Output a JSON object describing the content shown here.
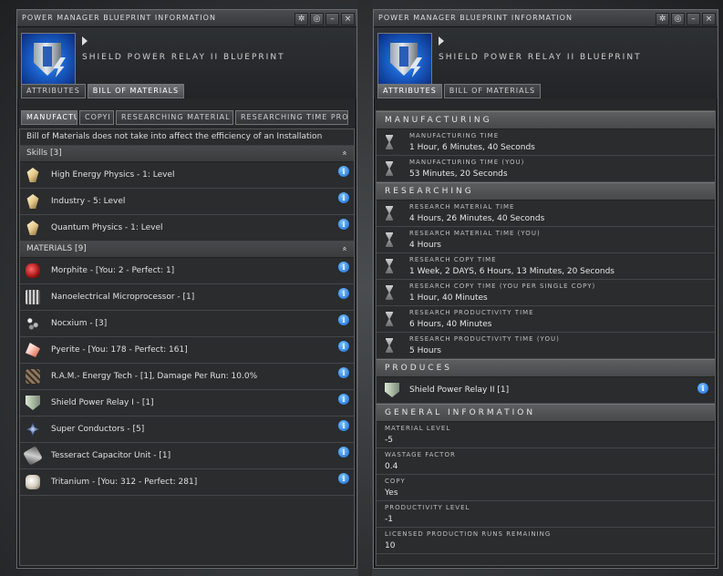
{
  "left_window": {
    "title": "Power Manager Blueprint Information",
    "blueprint_name": "Shield Power Relay II Blueprint",
    "tabs": [
      "Attributes",
      "Bill of Materials"
    ],
    "active_tab": 1,
    "subtabs": [
      "MANUFACTU",
      "COPYI",
      "RESEARCHING MATERIAL E",
      "RESEARCHING TIME PROD"
    ],
    "active_subtab": 0,
    "note": "Bill of Materials does not take into affect the efficiency of an Installation",
    "skills_header": "Skills [3]",
    "skills": [
      {
        "label": "High Energy Physics - 1: Level",
        "icon": "skillbook-icon"
      },
      {
        "label": "Industry - 5: Level",
        "icon": "skillbook-icon"
      },
      {
        "label": "Quantum Physics - 1: Level",
        "icon": "skillbook-icon"
      }
    ],
    "materials_header": "MATERIALS [9]",
    "materials": [
      {
        "label": "Morphite - [You: 2 - Perfect: 1]",
        "icon": "morphite-icon"
      },
      {
        "label": "Nanoelectrical Microprocessor - [1]",
        "icon": "microprocessor-icon"
      },
      {
        "label": "Nocxium - [3]",
        "icon": "nocxium-icon"
      },
      {
        "label": "Pyerite - [You: 178 - Perfect: 161]",
        "icon": "pyerite-icon"
      },
      {
        "label": "R.A.M.- Energy Tech - [1], Damage Per Run: 10.0%",
        "icon": "ram-icon"
      },
      {
        "label": "Shield Power Relay I - [1]",
        "icon": "shield-relay-icon"
      },
      {
        "label": "Super Conductors - [5]",
        "icon": "superconductor-icon"
      },
      {
        "label": "Tesseract Capacitor Unit - [1]",
        "icon": "tesseract-icon"
      },
      {
        "label": "Tritanium - [You: 312 - Perfect: 281]",
        "icon": "tritanium-icon"
      }
    ]
  },
  "right_window": {
    "title": "Power Manager Blueprint Information",
    "blueprint_name": "Shield Power Relay II Blueprint",
    "tabs": [
      "Attributes",
      "Bill of Materials"
    ],
    "active_tab": 0,
    "sections": {
      "manufacturing": "MANUFACTURING",
      "researching": "RESEARCHING",
      "produces": "PRODUCES",
      "general": "GENERAL INFORMATION"
    },
    "manufacturing": [
      {
        "key": "MANUFACTURING TIME",
        "value": "1 Hour, 6 Minutes, 40 Seconds"
      },
      {
        "key": "MANUFACTURING TIME (YOU)",
        "value": "53 Minutes, 20 Seconds"
      }
    ],
    "researching": [
      {
        "key": "RESEARCH MATERIAL TIME",
        "value": "4 Hours, 26 Minutes, 40 Seconds"
      },
      {
        "key": "RESEARCH MATERIAL TIME (YOU)",
        "value": "4 Hours"
      },
      {
        "key": "RESEARCH COPY TIME",
        "value": "1 Week, 2 DAYS, 6 Hours, 13 Minutes, 20 Seconds"
      },
      {
        "key": "RESEARCH COPY TIME (YOU PER SINGLE COPY)",
        "value": "1 Hour, 40 Minutes"
      },
      {
        "key": "RESEARCH PRODUCTIVITY TIME",
        "value": "6 Hours, 40 Minutes"
      },
      {
        "key": "RESEARCH PRODUCTIVITY TIME (YOU)",
        "value": "5 Hours"
      }
    ],
    "produces_item": "Shield Power Relay II [1]",
    "general": [
      {
        "key": "MATERIAL LEVEL",
        "value": "-5"
      },
      {
        "key": "WASTAGE FACTOR",
        "value": "0.4"
      },
      {
        "key": "COPY",
        "value": "Yes"
      },
      {
        "key": "PRODUCTIVITY LEVEL",
        "value": "-1"
      },
      {
        "key": "LICENSED PRODUCTION RUNS REMAINING",
        "value": "10"
      }
    ]
  },
  "window_buttons": {
    "pin": "✲",
    "minimize": "–",
    "close": "×",
    "settings": "◎"
  },
  "collapse_glyph": "»",
  "info_glyph": "i"
}
